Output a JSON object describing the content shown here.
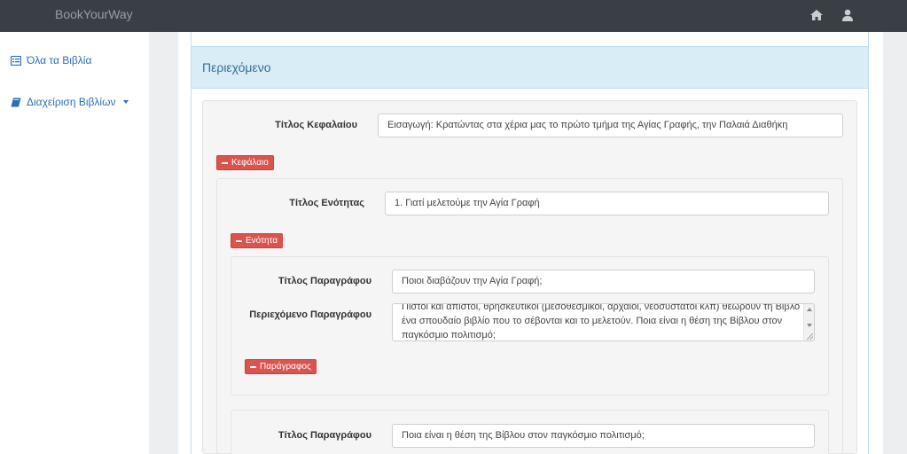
{
  "app": {
    "brand": "BookYourWay"
  },
  "navbar": {
    "home_icon": "home-icon",
    "user_icon": "user-icon"
  },
  "sidebar": {
    "items": [
      {
        "label": "Όλα τα Βιβλία",
        "icon": "list-alt-icon"
      },
      {
        "label": "Διαχείριση Βιβλίων",
        "icon": "book-icon",
        "has_dropdown": true
      }
    ]
  },
  "panel": {
    "title": "Περιεχόμενο"
  },
  "chapter": {
    "title_label": "Τίτλος Κεφαλαίου",
    "title_value": "Εισαγωγή: Κρατώντας στα χέρια μας το πρώτο τμήμα της Αγίας Γραφής, την Παλαιά Διαθήκη",
    "remove_label": "Κεφάλαιο"
  },
  "section": {
    "title_label": "Τίτλος Ενότητας",
    "title_value": "1. Γιατί μελετούμε την Αγία Γραφή",
    "remove_label": "Ενότητα"
  },
  "paragraphs": [
    {
      "title_label": "Τίτλος Παραγράφου",
      "title_value": "Ποιοι διαβάζουν την Αγία Γραφή;",
      "content_label": "Περιεχόμενο Παραγράφου",
      "content_lines": [
        "Πιστοί και άπιστοί, θρησκευτικοί (μεσοθεσμικοί, αρχαίοι, νεοσύστατοι κλπ) θεωρούν τη Βίβλο",
        "ένα σπουδαίο βιβλίο που το σέβονται και το μελετούν. Ποια είναι η θέση της Βίβλου στον",
        "παγκόσμιο πολιτισμό;"
      ],
      "remove_label": "Παράγραφος"
    },
    {
      "title_label": "Τίτλος Παραγράφου",
      "title_value": "Ποια είναι η θέση της Βίβλου στον παγκόσμιο πολιτισμό;"
    }
  ]
}
